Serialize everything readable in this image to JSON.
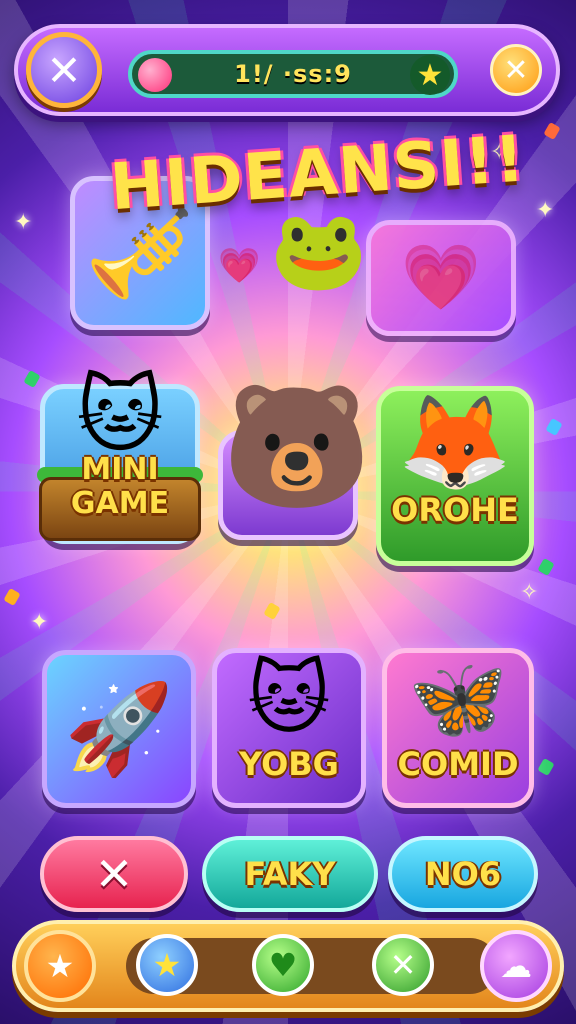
{
  "header": {
    "close_left_icon": "✕",
    "progress_text": "1!/ ·ss:9",
    "close_right_icon": "✕",
    "star_icon": "★"
  },
  "title": "HIDEANSI!!",
  "tiles": {
    "mini_game_label": "MINI GAME",
    "orohe_label": "OROHE",
    "yobg_label": "YOBG",
    "comid_label": "COMID"
  },
  "icons": {
    "trumpet": "🎺",
    "heart": "💗",
    "pet": "🐸",
    "cat": "🐱",
    "bear": "🐻",
    "fox": "🦊",
    "rocket": "🚀",
    "butterfly": "🦋",
    "crystal": "💎"
  },
  "actions": {
    "cancel_label": "✕",
    "faky_label": "FAKY",
    "no6_label": "NO6"
  },
  "bottom_nav": {
    "left_icon": "★",
    "star_icon": "★",
    "heart_icon": "♥",
    "x_icon": "✕",
    "right_icon": "☁"
  },
  "colors": {
    "accent_gold": "#ffe04a",
    "purple": "#7a2cd6",
    "green": "#2f9b2a"
  }
}
